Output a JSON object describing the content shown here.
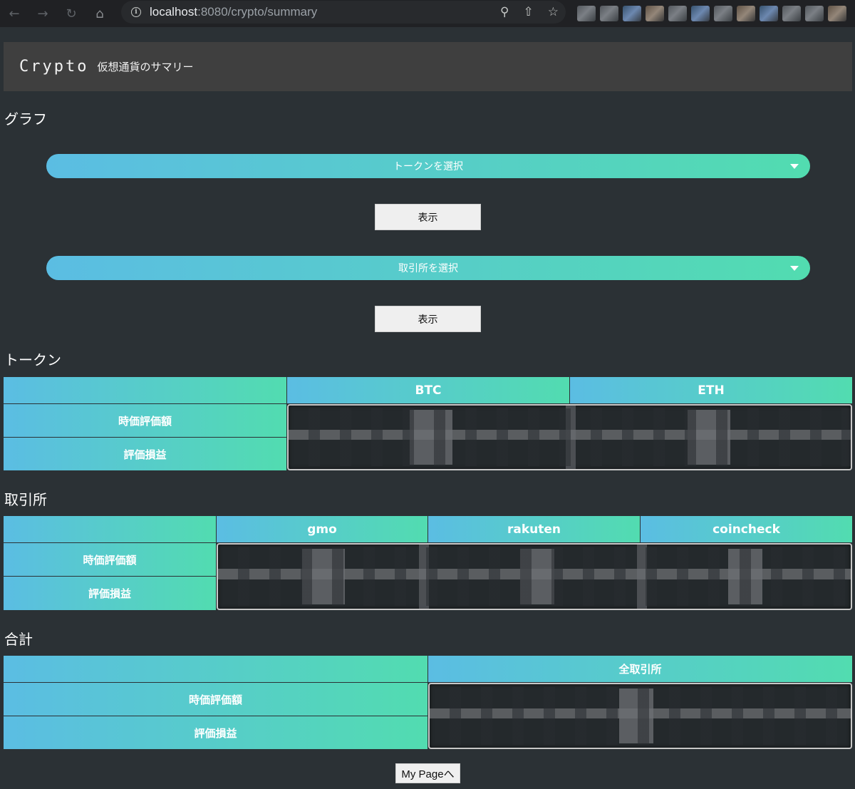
{
  "browser": {
    "url_host": "localhost",
    "url_rest": ":8080/crypto/summary"
  },
  "header": {
    "brand": "Crypto",
    "subtitle": "仮想通貨のサマリー"
  },
  "graph_section": {
    "title": "グラフ",
    "token_select_placeholder": "トークンを選択",
    "exchange_select_placeholder": "取引所を選択",
    "show_label": "表示"
  },
  "token_section": {
    "title": "トークン",
    "columns": [
      "BTC",
      "ETH"
    ],
    "rows": [
      "時価評価額",
      "評価損益"
    ]
  },
  "exchange_section": {
    "title": "取引所",
    "columns": [
      "gmo",
      "rakuten",
      "coincheck"
    ],
    "rows": [
      "時価評価額",
      "評価損益"
    ]
  },
  "total_section": {
    "title": "合計",
    "columns": [
      "全取引所"
    ],
    "rows": [
      "時価評価額",
      "評価損益"
    ]
  },
  "footer": {
    "mypage_label": "My Pageへ"
  },
  "colors": {
    "background": "#2b3135",
    "gradient_start": "#5bbde3",
    "gradient_end": "#52dcb0",
    "header_bg": "#3f3f3f"
  }
}
